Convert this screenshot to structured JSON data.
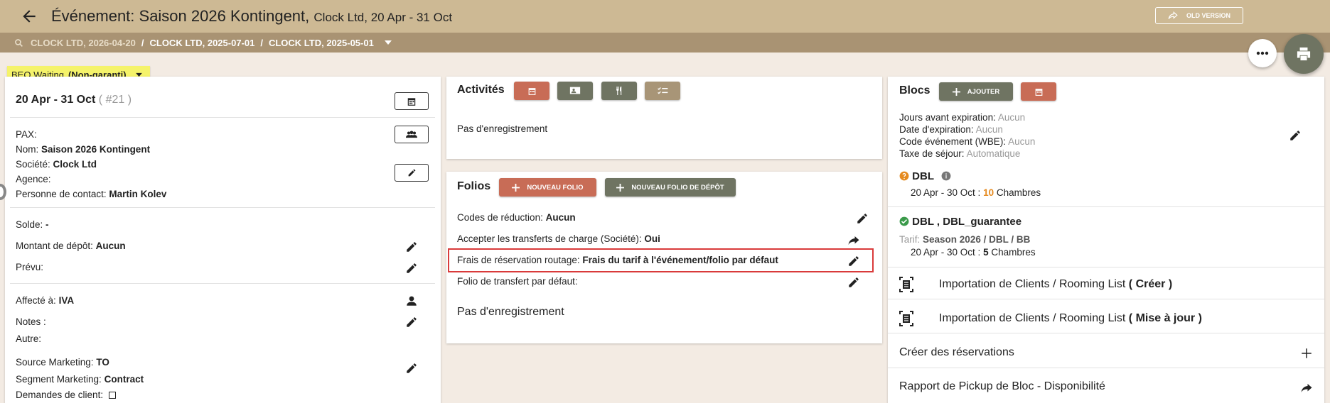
{
  "header": {
    "title": "Événement: Saison 2026 Kontingent,",
    "subtitle": "Clock Ltd, 20 Apr - 31 Oct",
    "old_version": "OLD VERSION"
  },
  "breadcrumb": {
    "items": [
      "CLOCK LTD, 2026-04-20",
      "CLOCK LTD, 2025-07-01",
      "CLOCK LTD, 2025-05-01"
    ]
  },
  "beo": {
    "status": "BEO Waiting",
    "type": "(Non-garanti)"
  },
  "left": {
    "dates": "20 Apr - 31 Oct",
    "number": "( #21 )",
    "pax_label": "PAX:",
    "nom_label": "Nom:",
    "nom_value": "Saison 2026 Kontingent",
    "societe_label": "Société:",
    "societe_value": "Clock Ltd",
    "agence_label": "Agence:",
    "contact_label": "Personne de contact:",
    "contact_value": "Martin Kolev",
    "solde_label": "Solde:",
    "solde_value": "-",
    "depot_label": "Montant de dépôt:",
    "depot_value": "Aucun",
    "prevu_label": "Prévu:",
    "affecte_label": "Affecté à:",
    "affecte_value": "IVA",
    "notes_label": "Notes :",
    "autre_label": "Autre:",
    "source_label": "Source Marketing:",
    "source_value": "TO",
    "segment_label": "Segment Marketing:",
    "segment_value": "Contract",
    "demandes_label": "Demandes de client:"
  },
  "activites": {
    "title": "Activités",
    "empty": "Pas d'enregistrement"
  },
  "folios": {
    "title": "Folios",
    "new_folio": "NOUVEAU FOLIO",
    "new_deposit_folio": "NOUVEAU FOLIO DE DÉPÔT",
    "codes_label": "Codes de réduction:",
    "codes_value": "Aucun",
    "transferts_label": "Accepter les transferts de charge (Société):",
    "transferts_value": "Oui",
    "frais_label": "Frais de réservation routage:",
    "frais_value": "Frais du tarif à l'événement/folio par défaut",
    "folio_transfert_label": "Folio de transfert par défaut:",
    "empty": "Pas d'enregistrement"
  },
  "blocs": {
    "title": "Blocs",
    "add": "AJOUTER",
    "jours_label": "Jours avant expiration:",
    "jours_value": "Aucun",
    "date_label": "Date d'expiration:",
    "date_value": "Aucun",
    "code_label": "Code événement (WBE):",
    "code_value": "Aucun",
    "taxe_label": "Taxe de séjour:",
    "taxe_value": "Automatique",
    "b1_name": "DBL",
    "b1_dates": "20 Apr - 30 Oct :",
    "b1_count": "10",
    "b1_unit": "Chambres",
    "b2_name": "DBL , DBL_guarantee",
    "b2_tarif_label": "Tarif:",
    "b2_tarif_value": "Season 2026 / DBL / BB",
    "b2_dates": "20 Apr - 30 Oct :",
    "b2_count": "5",
    "b2_unit": "Chambres",
    "import_label": "Importation de Clients / Rooming List",
    "import_create": "( Créer )",
    "import_update": "( Mise à jour )",
    "create_res": "Créer des réservations",
    "pickup": "Rapport de Pickup de Bloc - Disponibilité"
  },
  "colors": {
    "header_bg": "#cdb994",
    "crumb_bg": "#a99373",
    "accent_red": "#c86c56",
    "accent_dark": "#6f7462",
    "beo_yellow": "#f5f36a"
  }
}
